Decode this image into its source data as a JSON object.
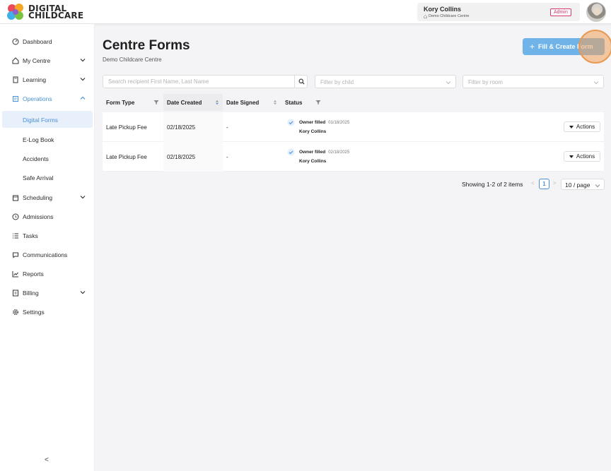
{
  "header": {
    "logo_line1": "DIGITAL",
    "logo_line2": "CHILDCARE",
    "user_name": "Kory Collins",
    "user_centre": "Demo Childcare Centre",
    "role_badge": "Admin"
  },
  "sidebar": {
    "items": [
      {
        "label": "Dashboard"
      },
      {
        "label": "My Centre"
      },
      {
        "label": "Learning"
      },
      {
        "label": "Operations"
      },
      {
        "label": "Scheduling"
      },
      {
        "label": "Admissions"
      },
      {
        "label": "Tasks"
      },
      {
        "label": "Communications"
      },
      {
        "label": "Reports"
      },
      {
        "label": "Billing"
      },
      {
        "label": "Settings"
      }
    ],
    "operations_sub": [
      {
        "label": "Digital Forms"
      },
      {
        "label": "E-Log Book"
      },
      {
        "label": "Accidents"
      },
      {
        "label": "Safe Arrival"
      }
    ],
    "collapse_label": "<"
  },
  "main": {
    "title": "Centre Forms",
    "subtitle": "Demo Childcare Centre",
    "fill_button": "Fill & Create Form",
    "fill_button_plus": "+",
    "search_placeholder": "Search recipient First Name, Last Name",
    "filter_child": "Filter by child",
    "filter_room": "Filter by room"
  },
  "table": {
    "columns": [
      "Form Type",
      "Date Created",
      "Date Signed",
      "Status"
    ],
    "rows": [
      {
        "form_type": "Late Pickup Fee",
        "date_created": "02/18/2025",
        "date_signed": "-",
        "status": "Owner filled",
        "status_date": "01/18/2025",
        "status_by": "Kory Collins",
        "action": "Actions"
      },
      {
        "form_type": "Late Pickup Fee",
        "date_created": "02/18/2025",
        "date_signed": "-",
        "status": "Owner filled",
        "status_date": "02/18/2025",
        "status_by": "Kory Collins",
        "action": "Actions"
      }
    ]
  },
  "pagination": {
    "summary": "Showing 1-2 of 2 items",
    "prev": "<",
    "current_page": "1",
    "next": ">",
    "page_size": "10 / page"
  },
  "colors": {
    "accent": "#4a90d9",
    "button": "#6fb3e8",
    "admin_badge": "#d23a6b"
  }
}
